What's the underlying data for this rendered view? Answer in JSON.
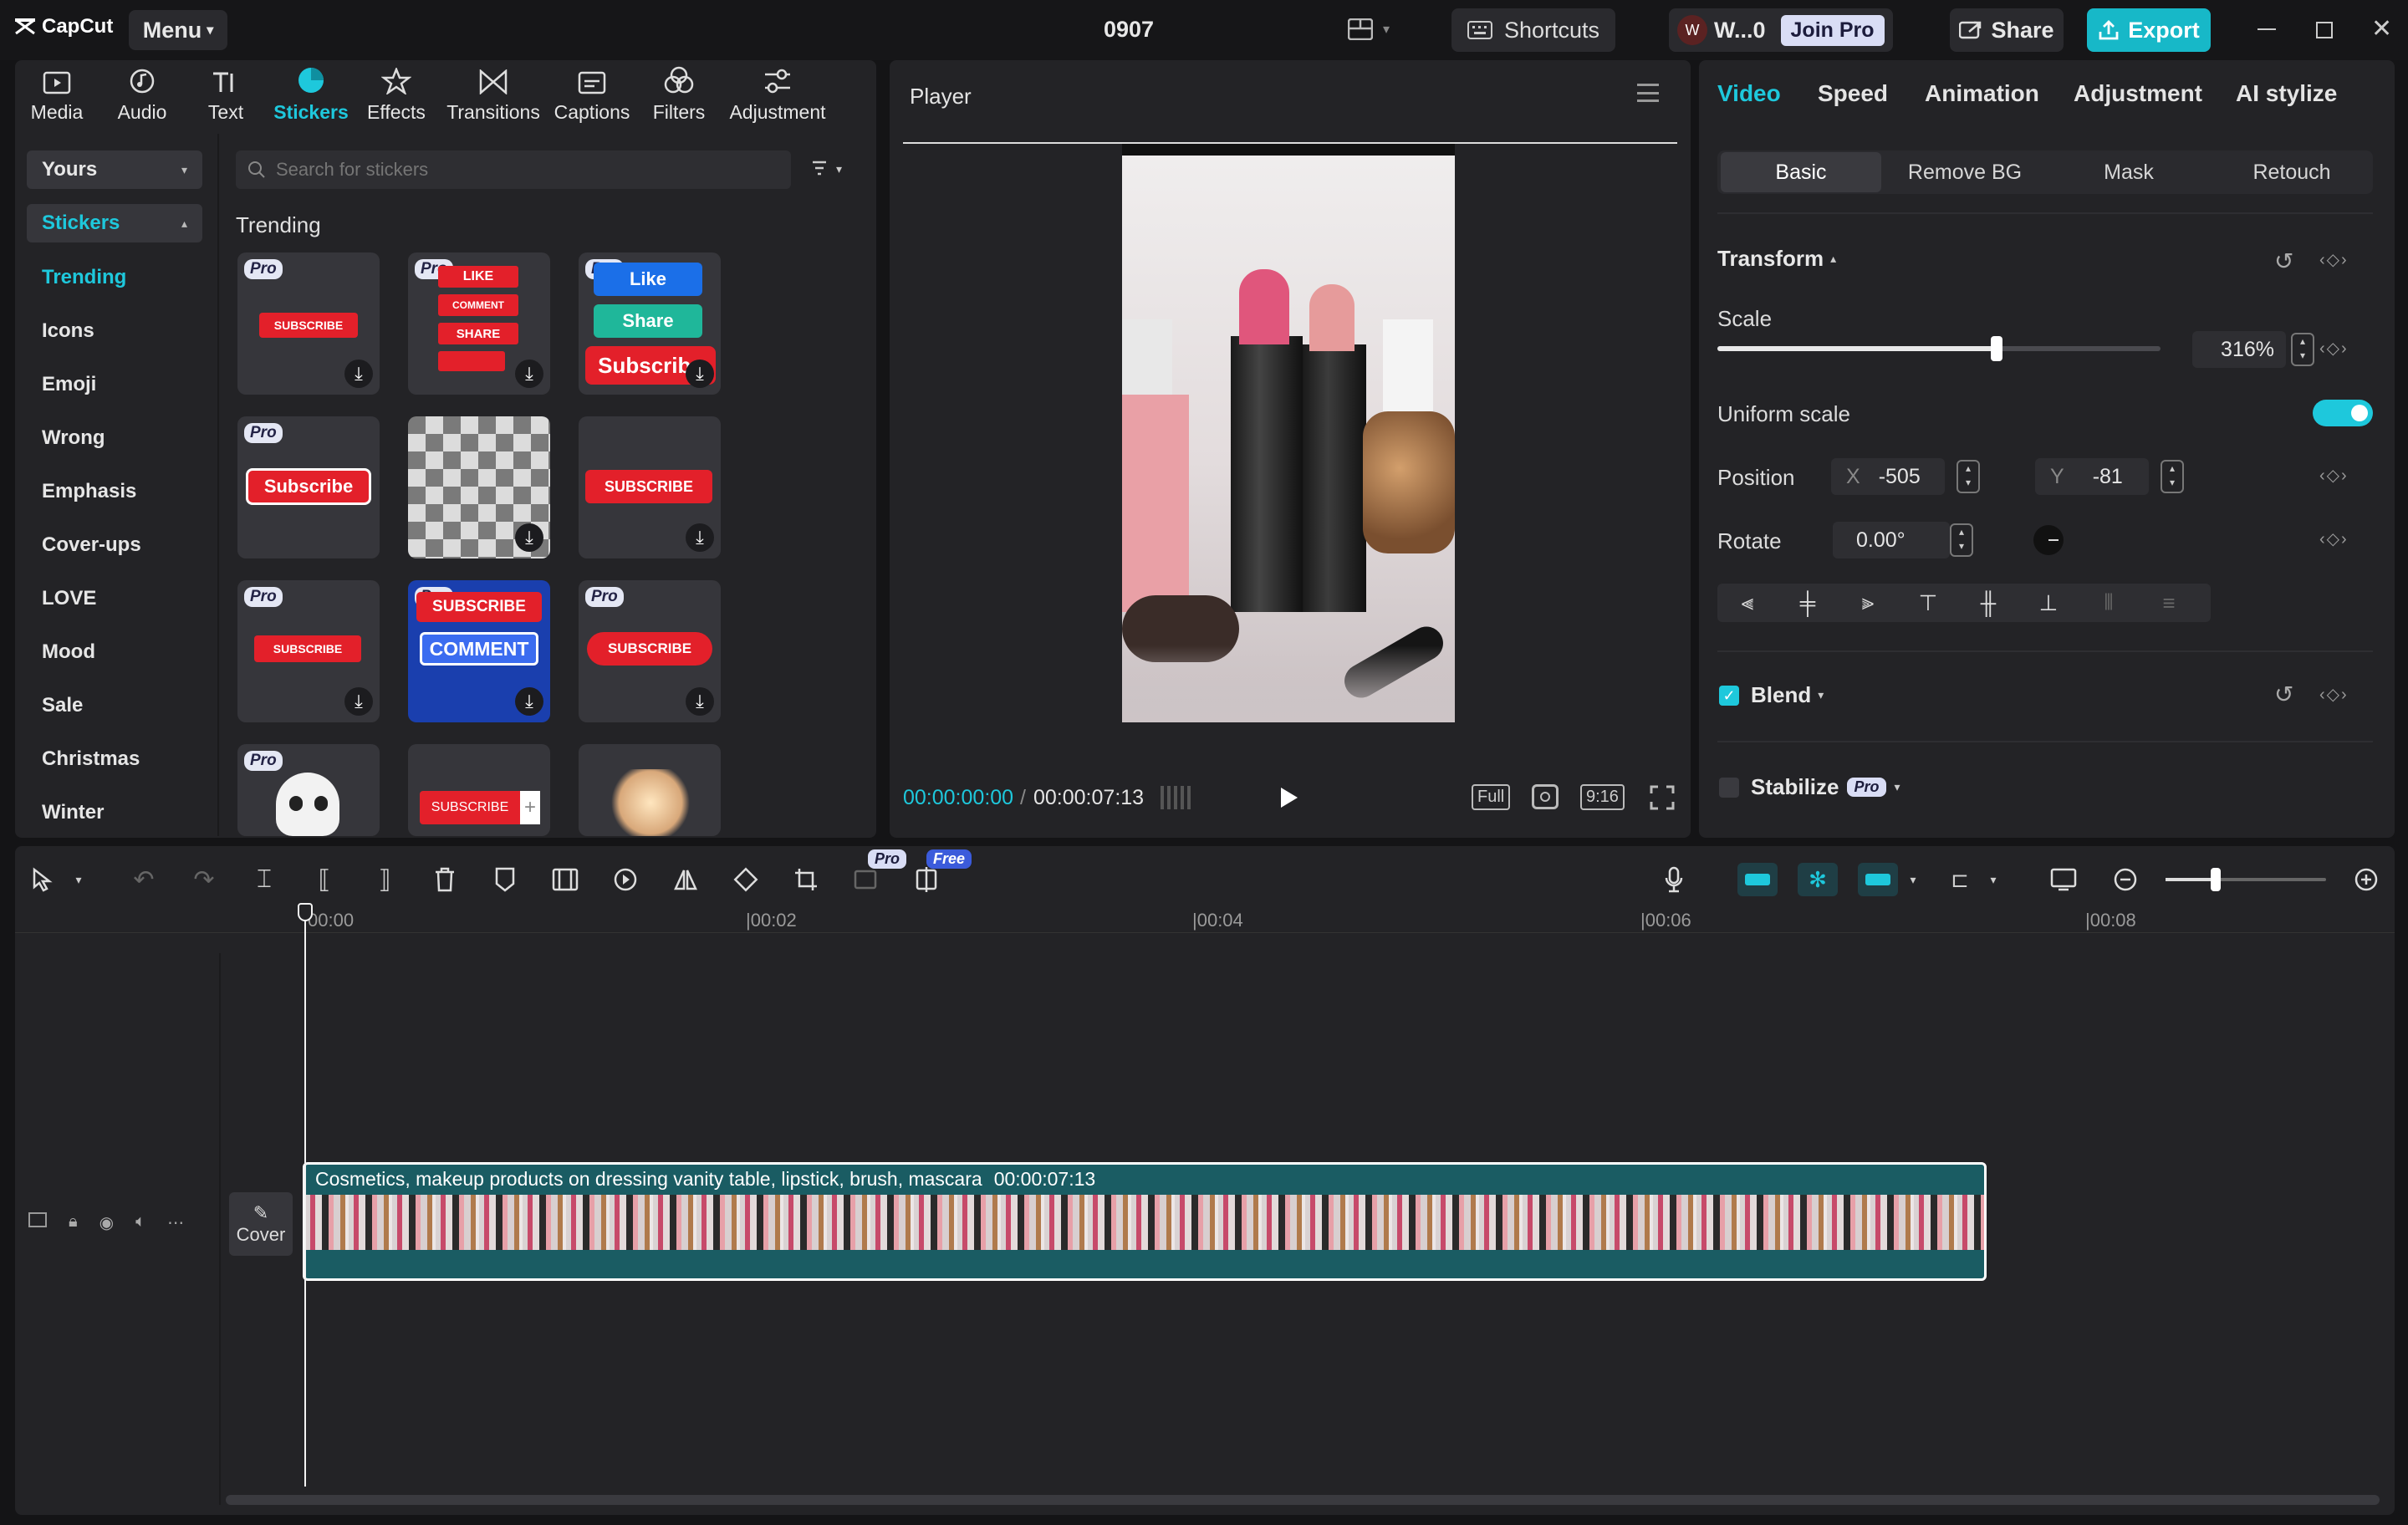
{
  "titlebar": {
    "logo": "CapCut",
    "menu_label": "Menu",
    "project_name": "0907",
    "shortcuts_label": "Shortcuts",
    "user_label": "W...0",
    "user_initial": "W",
    "join_pro_label": "Join Pro",
    "share_label": "Share",
    "export_label": "Export",
    "export_color": "#17b8c8"
  },
  "toolbar": {
    "items": [
      {
        "label": "Media",
        "icon": "media-icon"
      },
      {
        "label": "Audio",
        "icon": "audio-icon"
      },
      {
        "label": "Text",
        "icon": "text-icon"
      },
      {
        "label": "Stickers",
        "icon": "stickers-icon",
        "active": true
      },
      {
        "label": "Effects",
        "icon": "effects-icon"
      },
      {
        "label": "Transitions",
        "icon": "transitions-icon"
      },
      {
        "label": "Captions",
        "icon": "captions-icon"
      },
      {
        "label": "Filters",
        "icon": "filters-icon"
      },
      {
        "label": "Adjustment",
        "icon": "adjustment-icon"
      }
    ],
    "active_color": "#1ec8dc"
  },
  "sidebar": {
    "yours_label": "Yours",
    "stickers_label": "Stickers",
    "categories": [
      "Trending",
      "Icons",
      "Emoji",
      "Wrong",
      "Emphasis",
      "Cover-ups",
      "LOVE",
      "Mood",
      "Sale",
      "Christmas",
      "Winter"
    ]
  },
  "stickers": {
    "search_placeholder": "Search for stickers",
    "section_title": "Trending",
    "pro_badge": "Pro",
    "text": {
      "subscribe_small": "SUBSCRIBE",
      "like": "LIKE",
      "comment_small": "COMMENT",
      "share_small": "SHARE",
      "like2": "Like",
      "share2": "Share",
      "subscribe2": "Subscribe",
      "subscribe3": "Subscribe",
      "subscribe4": "SUBSCRIBE",
      "subscribe5": "SUBSCRIBE",
      "subscribe6": "SUBSCRIBE",
      "comment6": "COMMENT",
      "subscribe7": "SUBSCRIBE",
      "subscribe8": "SUBSCRIBE"
    }
  },
  "player": {
    "title": "Player",
    "current_time": "00:00:00:00",
    "total_time": "00:00:07:13",
    "full_label": "Full",
    "ratio_label": "9:16"
  },
  "properties": {
    "tabs": [
      "Video",
      "Speed",
      "Animation",
      "Adjustment",
      "AI stylize"
    ],
    "subtabs": [
      "Basic",
      "Remove BG",
      "Mask",
      "Retouch"
    ],
    "transform_label": "Transform",
    "scale_label": "Scale",
    "scale_value": "316%",
    "scale_fraction": 0.63,
    "uniform_scale_label": "Uniform scale",
    "position_label": "Position",
    "x_label": "X",
    "x_value": "-505",
    "y_label": "Y",
    "y_value": "-81",
    "rotate_label": "Rotate",
    "rotate_value": "0.00°",
    "blend_label": "Blend",
    "stabilize_label": "Stabilize",
    "pro_badge": "Pro"
  },
  "timeline": {
    "pro_badge": "Pro",
    "free_badge": "Free",
    "ruler": [
      "00:00",
      "00:02",
      "00:04",
      "00:06",
      "00:08"
    ],
    "cover_label": "Cover",
    "clip_title": "Cosmetics, makeup products on dressing vanity table, lipstick, brush, mascara",
    "clip_duration": "00:00:07:13"
  }
}
